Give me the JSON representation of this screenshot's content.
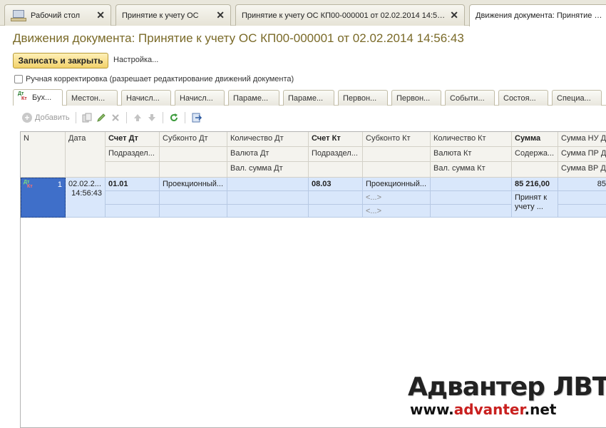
{
  "window_tabs": [
    {
      "label": "Рабочий стол",
      "close": "✕"
    },
    {
      "label": "Принятие к учету ОС",
      "close": "✕"
    },
    {
      "label": "Принятие к учету ОС КП00-000001 от 02.02.2014 14:56:...",
      "close": "✕"
    },
    {
      "label": "Движения документа: Принятие к у"
    }
  ],
  "page_title": "Движения документа: Принятие к учету ОС КП00-000001 от 02.02.2014 14:56:43",
  "toolbar_top": {
    "save_close_label": "Записать и закрыть",
    "settings_label": "Настройка..."
  },
  "manual_checkbox": {
    "label": "Ручная корректировка (разрешает редактирование движений документа)",
    "checked": false
  },
  "inner_tabs": [
    "Бух...",
    "Местон...",
    "Начисл...",
    "Начисл...",
    "Параме...",
    "Параме...",
    "Первон...",
    "Первон...",
    "Событи...",
    "Состоя...",
    "Специа..."
  ],
  "inner_tab_icon": {
    "top": "Дт",
    "bottom": "Кт"
  },
  "grid_toolbar": {
    "add_label": "Добавить"
  },
  "grid": {
    "header": {
      "n": "N",
      "date": "Дата",
      "acc_dt": "Счет Дт",
      "acc_dt_sub": "Подраздел...",
      "subkonto_dt": "Субконто Дт",
      "qty_dt": "Количество Дт",
      "cur_dt": "Валюта Дт",
      "cur_sum_dt": "Вал. сумма Дт",
      "acc_kt": "Счет Кт",
      "acc_kt_sub": "Подраздел...",
      "subkonto_kt": "Субконто Кт",
      "qty_kt": "Количество Кт",
      "cur_kt": "Валюта Кт",
      "cur_sum_kt": "Вал. сумма Кт",
      "sum": "Сумма",
      "content": "Содержа...",
      "sum_nu": "Сумма НУ Д",
      "sum_pr": "Сумма ПР Д",
      "sum_vr": "Сумма ВР Д"
    },
    "rows": [
      {
        "n": "1",
        "date": "02.02.2...",
        "time": "14:56:43",
        "acc_dt": "01.01",
        "subkonto_dt": "Проекционный...",
        "acc_kt": "08.03",
        "subkonto_kt": "Проекционный...",
        "subkonto_kt2": "<...>",
        "subkonto_kt3": "<...>",
        "sum": "85 216,00",
        "content": "Принят к учету ...",
        "sum_nu": "85"
      }
    ]
  },
  "watermark": {
    "line1": "Адвантер ЛВТИ",
    "line2_prefix": "www.",
    "line2_brand": "advanter",
    "line2_suffix": ".net"
  }
}
